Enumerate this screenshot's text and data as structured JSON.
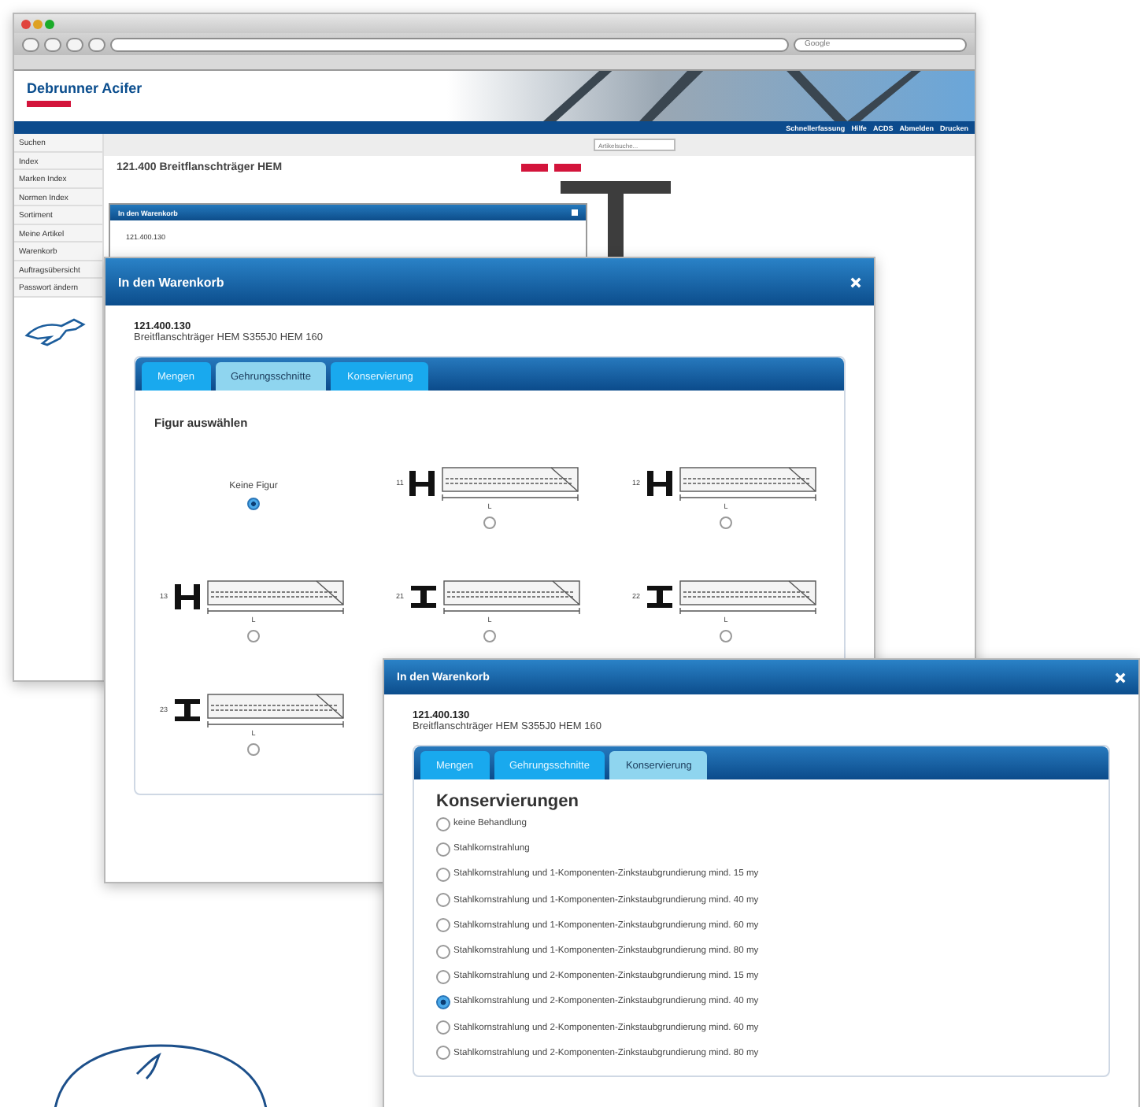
{
  "browser": {
    "search": {
      "placeholder": "Google"
    },
    "site": {
      "logo": "Debrunner Acifer",
      "top_nav": [
        "Schnellerfassung",
        "Hilfe",
        "ACDS",
        "Abmelden",
        "Drucken"
      ],
      "sidebar": [
        {
          "label": "Suchen"
        },
        {
          "label": "Index"
        },
        {
          "label": "Marken Index"
        },
        {
          "label": "Normen Index"
        },
        {
          "label": "Sortiment"
        },
        {
          "label": "Meine Artikel"
        },
        {
          "label": "Warenkorb"
        },
        {
          "label": "Auftragsübersicht"
        },
        {
          "label": "Passwort ändern"
        }
      ],
      "site_search": {
        "placeholder": "Artikelsuche..."
      },
      "heading": "121.400 Breitflanschträger HEM",
      "small_dialog": {
        "title": "In den Warenkorb",
        "code": "121.400.130"
      }
    }
  },
  "dialog_figures": {
    "title": "In den Warenkorb",
    "code": "121.400.130",
    "name": "Breitflanschträger HEM S355J0 HEM 160",
    "tabs": [
      {
        "label": "Mengen",
        "selected": false
      },
      {
        "label": "Gehrungsschnitte",
        "selected": true
      },
      {
        "label": "Konservierung",
        "selected": false
      }
    ],
    "section_title": "Figur auswählen",
    "figures": [
      {
        "kind": "none",
        "label": "Keine Figur",
        "selected": true
      },
      {
        "kind": "hbeam",
        "number": "11",
        "dimension": "L",
        "selected": false
      },
      {
        "kind": "hbeam",
        "number": "12",
        "dimension": "L",
        "selected": false
      },
      {
        "kind": "hbeam",
        "number": "13",
        "dimension": "L",
        "selected": false
      },
      {
        "kind": "ibeam",
        "number": "21",
        "dimension": "L",
        "selected": false
      },
      {
        "kind": "ibeam",
        "number": "22",
        "dimension": "L",
        "selected": false
      },
      {
        "kind": "ibeam",
        "number": "23",
        "dimension": "L",
        "selected": false
      }
    ]
  },
  "dialog_conservation": {
    "title": "In den Warenkorb",
    "code": "121.400.130",
    "name": "Breitflanschträger HEM S355J0 HEM 160",
    "tabs": [
      {
        "label": "Mengen",
        "selected": false
      },
      {
        "label": "Gehrungsschnitte",
        "selected": false
      },
      {
        "label": "Konservierung",
        "selected": true
      }
    ],
    "section_title": "Konservierungen",
    "options": [
      {
        "label": "keine Behandlung",
        "selected": false
      },
      {
        "label": "Stahlkornstrahlung",
        "selected": false
      },
      {
        "label": "Stahlkornstrahlung und 1-Komponenten-Zinkstaubgrundierung mind. 15 my",
        "selected": false
      },
      {
        "label": "Stahlkornstrahlung und 1-Komponenten-Zinkstaubgrundierung mind. 40 my",
        "selected": false
      },
      {
        "label": "Stahlkornstrahlung und 1-Komponenten-Zinkstaubgrundierung mind. 60 my",
        "selected": false
      },
      {
        "label": "Stahlkornstrahlung und 1-Komponenten-Zinkstaubgrundierung mind. 80 my",
        "selected": false
      },
      {
        "label": "Stahlkornstrahlung und 2-Komponenten-Zinkstaubgrundierung mind. 15 my",
        "selected": false
      },
      {
        "label": "Stahlkornstrahlung und 2-Komponenten-Zinkstaubgrundierung mind. 40 my",
        "selected": true
      },
      {
        "label": "Stahlkornstrahlung und 2-Komponenten-Zinkstaubgrundierung mind. 60 my",
        "selected": false
      },
      {
        "label": "Stahlkornstrahlung und 2-Komponenten-Zinkstaubgrundierung mind. 80 my",
        "selected": false
      }
    ]
  }
}
